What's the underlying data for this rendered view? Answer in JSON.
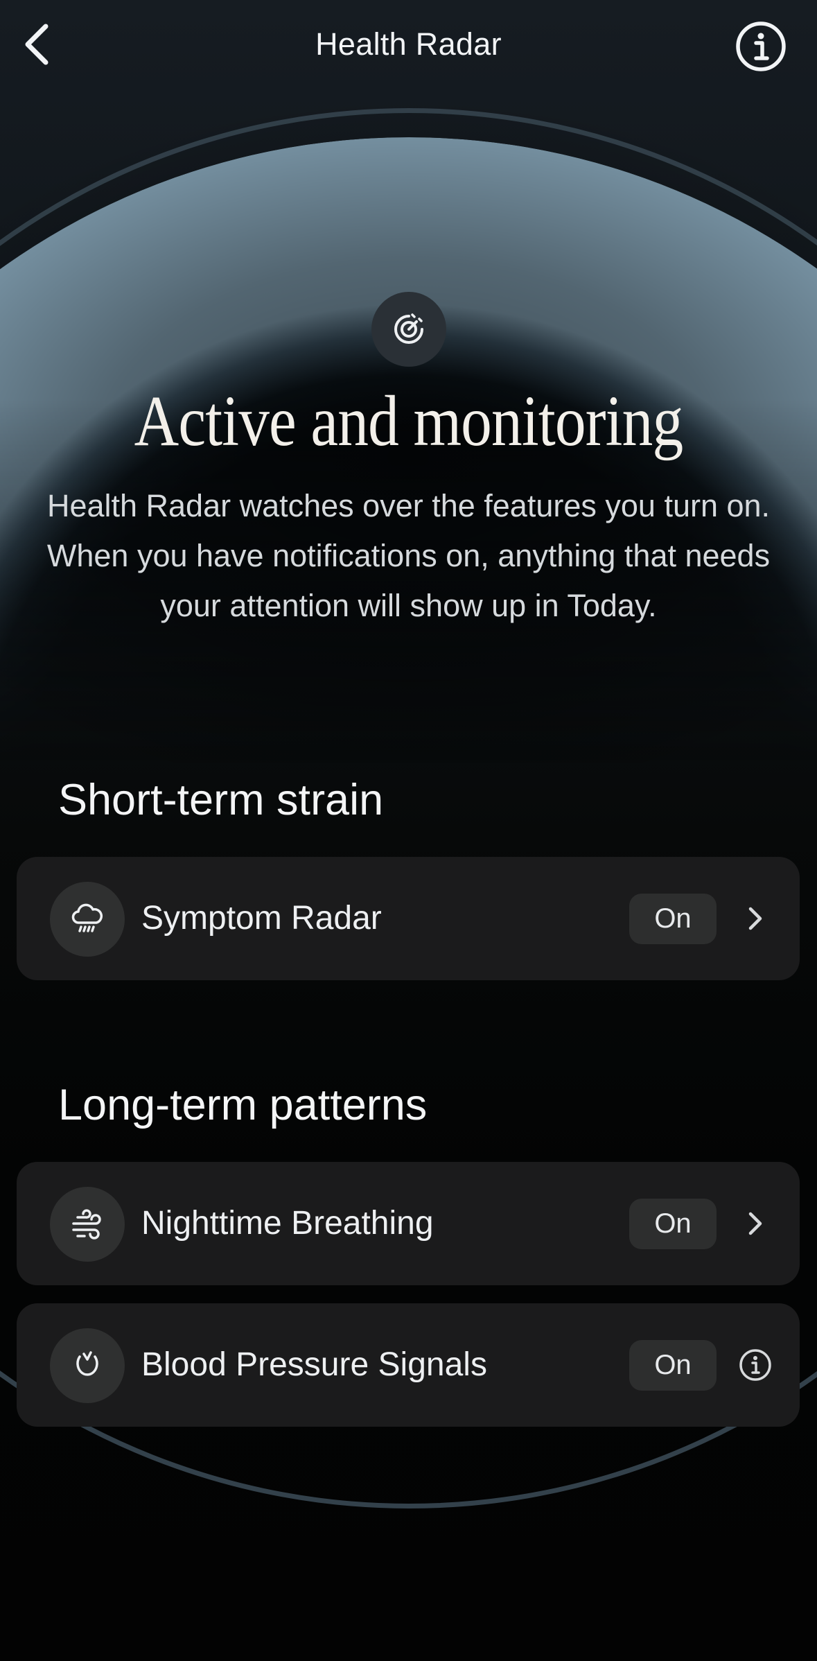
{
  "header": {
    "title": "Health Radar",
    "back_icon": "chevron-left-icon",
    "info_icon": "info-circle-icon"
  },
  "hero": {
    "icon": "radar-icon",
    "title": "Active and monitoring",
    "description": "Health Radar watches over the features you turn on. When you have notifications on, anything that needs your attention will show up in Today."
  },
  "sections": {
    "short_term": {
      "title": "Short-term strain",
      "items": [
        {
          "label": "Symptom Radar",
          "status": "On",
          "icon": "cloud-rain-icon",
          "trailing": "chevron-right-icon"
        }
      ]
    },
    "long_term": {
      "title": "Long-term patterns",
      "items": [
        {
          "label": "Nighttime Breathing",
          "status": "On",
          "icon": "wind-icon",
          "trailing": "chevron-right-icon"
        },
        {
          "label": "Blood Pressure Signals",
          "status": "On",
          "icon": "heart-pulse-icon",
          "trailing": "info-circle-icon"
        }
      ]
    }
  },
  "colors": {
    "background": "#040506",
    "card": "#1b1b1c",
    "pill": "#2d2e2e",
    "dome_highlight": "#7f9cae",
    "text": "#eceef0"
  }
}
